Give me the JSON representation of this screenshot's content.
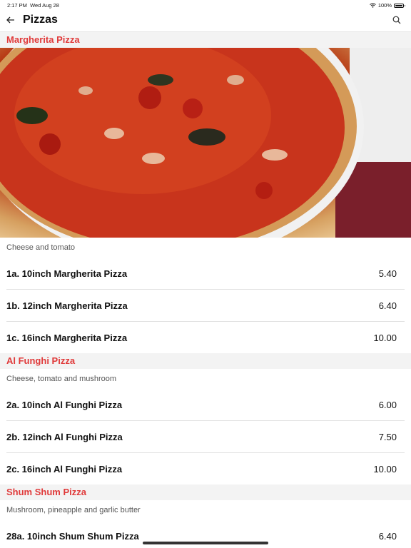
{
  "status_bar": {
    "time": "2:17 PM",
    "date": "Wed Aug 28",
    "wifi_icon": "wifi-icon",
    "battery": "100%"
  },
  "app_bar": {
    "back_icon": "arrow-left-icon",
    "title": "Pizzas",
    "search_icon": "search-icon"
  },
  "sections": [
    {
      "title": "Margherita Pizza",
      "description": "Cheese and tomato",
      "items": [
        {
          "name": "1a. 10inch Margherita Pizza",
          "price": "5.40"
        },
        {
          "name": "1b. 12inch Margherita Pizza",
          "price": "6.40"
        },
        {
          "name": "1c. 16inch Margherita Pizza",
          "price": "10.00"
        }
      ]
    },
    {
      "title": "Al Funghi Pizza",
      "description": "Cheese, tomato and mushroom",
      "items": [
        {
          "name": "2a. 10inch Al Funghi Pizza",
          "price": "6.00"
        },
        {
          "name": "2b. 12inch Al Funghi Pizza",
          "price": "7.50"
        },
        {
          "name": "2c. 16inch Al Funghi Pizza",
          "price": "10.00"
        }
      ]
    },
    {
      "title": "Shum Shum Pizza",
      "description": "Mushroom, pineapple and garlic butter",
      "items": [
        {
          "name": "28a. 10inch Shum Shum Pizza",
          "price": "6.40"
        }
      ]
    }
  ]
}
